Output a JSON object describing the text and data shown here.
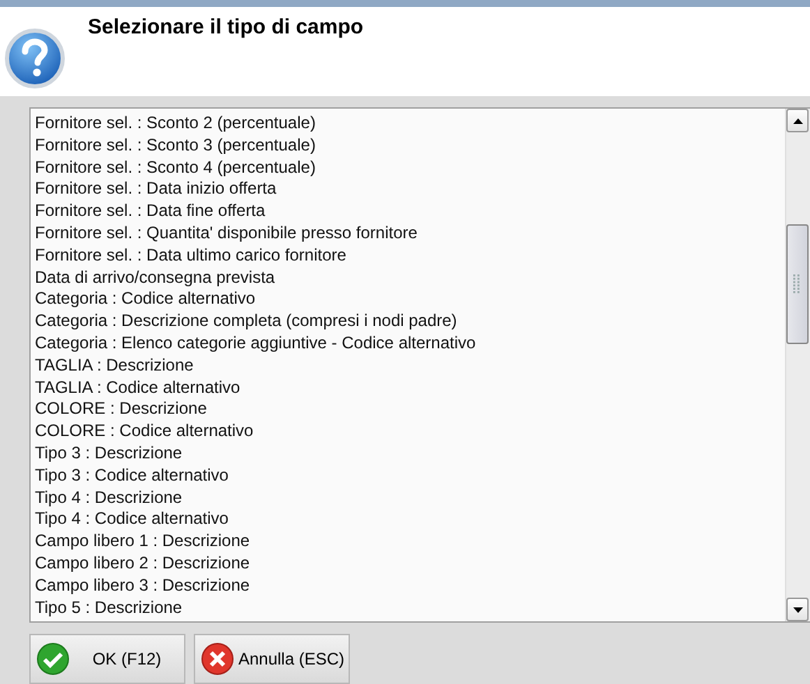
{
  "dialog": {
    "title": "Selezionare il tipo di campo"
  },
  "list": {
    "items": [
      "Fornitore sel. : Sconto 2 (percentuale)",
      "Fornitore sel. : Sconto 3 (percentuale)",
      "Fornitore sel. : Sconto 4 (percentuale)",
      "Fornitore sel. : Data inizio offerta",
      "Fornitore sel. : Data fine offerta",
      "Fornitore sel. : Quantita' disponibile presso fornitore",
      "Fornitore sel. : Data ultimo carico fornitore",
      "Data di arrivo/consegna prevista",
      "Categoria : Codice alternativo",
      "Categoria : Descrizione completa (compresi i nodi padre)",
      "Categoria : Elenco categorie aggiuntive - Codice alternativo",
      "TAGLIA : Descrizione",
      "TAGLIA : Codice alternativo",
      "COLORE : Descrizione",
      "COLORE : Codice alternativo",
      "Tipo 3 : Descrizione",
      "Tipo 3 : Codice alternativo",
      "Tipo 4 : Descrizione",
      "Tipo 4 : Codice alternativo",
      "Campo libero 1 : Descrizione",
      "Campo libero 2 : Descrizione",
      "Campo libero 3 : Descrizione",
      "Tipo 5 : Descrizione"
    ]
  },
  "buttons": [
    {
      "kind": "ok",
      "label": "OK (F12)"
    },
    {
      "kind": "cancel",
      "label": "Annulla (ESC)"
    }
  ]
}
